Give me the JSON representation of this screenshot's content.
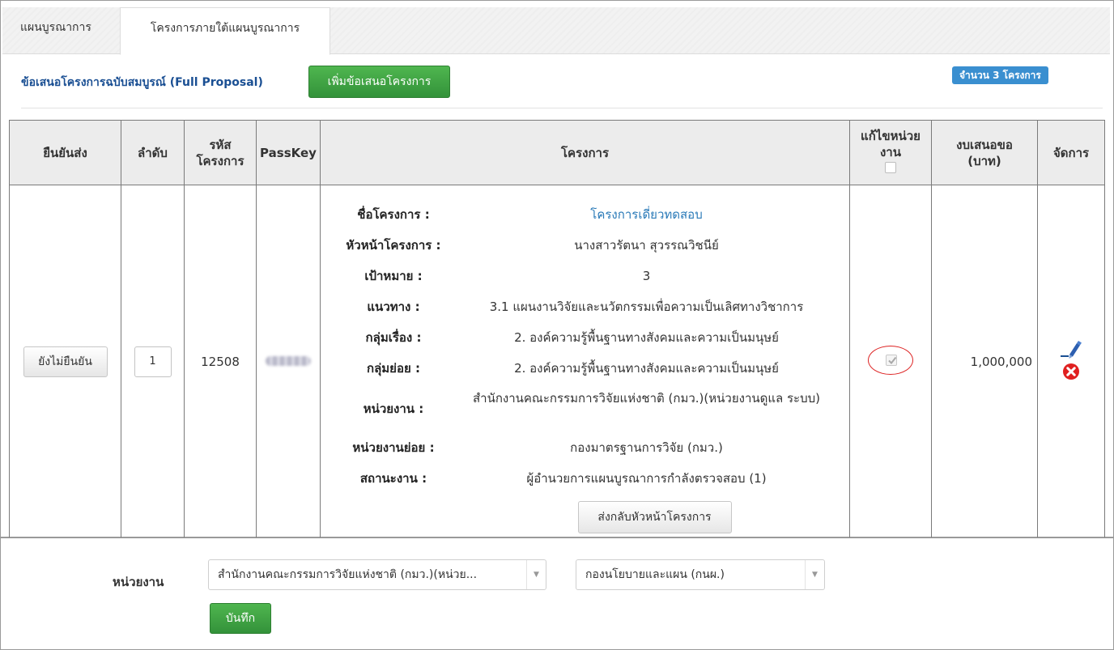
{
  "tabs": {
    "plan": "แผนบูรณาการ",
    "projects": "โครงการภายใต้แผนบูรณาการ"
  },
  "section": {
    "title": "ข้อเสนอโครงการฉบับสมบูรณ์ (Full Proposal)",
    "add_button": "เพิ่มข้อเสนอโครงการ",
    "count_badge": "จำนวน 3 โครงการ"
  },
  "table": {
    "headers": {
      "confirm": "ยืนยันส่ง",
      "order": "ลำดับ",
      "code": "รหัส\nโครงการ",
      "passkey": "PassKey",
      "project": "โครงการ",
      "edit_unit": "แก้ไขหน่วย\nงาน",
      "budget": "งบเสนอขอ\n(บาท)",
      "manage": "จัดการ"
    },
    "row": {
      "confirm_button": "ยังไม่ยืนยัน",
      "order": "1",
      "code": "12508",
      "edit_unit_checked": true,
      "budget": "1,000,000",
      "details": [
        {
          "label": "ชื่อโครงการ :",
          "value": "โครงการเดี่ยวทดสอบ"
        },
        {
          "label": "หัวหน้าโครงการ :",
          "value": "นางสาวรัตนา สุวรรณวิชนีย์"
        },
        {
          "label": "เป้าหมาย :",
          "value": "3"
        },
        {
          "label": "แนวทาง :",
          "value": "3.1 แผนงานวิจัยและนวัตกรรมเพื่อความเป็นเลิศทางวิชาการ"
        },
        {
          "label": "กลุ่มเรื่อง :",
          "value": "2. องค์ความรู้พื้นฐานทางสังคมและความเป็นมนุษย์"
        },
        {
          "label": "กลุ่มย่อย :",
          "value": "2. องค์ความรู้พื้นฐานทางสังคมและความเป็นมนุษย์"
        },
        {
          "label": "หน่วยงาน :",
          "value": "สำนักงานคณะกรรมการวิจัยแห่งชาติ (กมว.)(หน่วยงานดูแล ระบบ)"
        },
        {
          "label": "หน่วยงานย่อย :",
          "value": "กองมาตรฐานการวิจัย (กมว.)"
        },
        {
          "label": "สถานะงาน :",
          "value": "ผู้อำนวยการแผนบูรณาการกำลังตรวจสอบ (1)"
        }
      ],
      "return_button": "ส่งกลับหัวหน้าโครงการ"
    }
  },
  "bottom": {
    "unit_label": "หน่วยงาน",
    "unit_select": "สำนักงานคณะกรรมการวิจัยแห่งชาติ (กมว.)(หน่วย...",
    "subunit_select": "กองนโยบายและแผน (กนผ.)",
    "save_button": "บันทึก"
  },
  "colors": {
    "green_button": "#3aa13f",
    "badge_blue": "#3a8fd0",
    "title_blue": "#1a4f93",
    "link_blue": "#2a7ab8",
    "highlight_red": "#dd2222"
  },
  "icons": [
    "edit-pencil-icon",
    "delete-x-icon",
    "checkmark-icon",
    "dropdown-arrow-icon"
  ]
}
